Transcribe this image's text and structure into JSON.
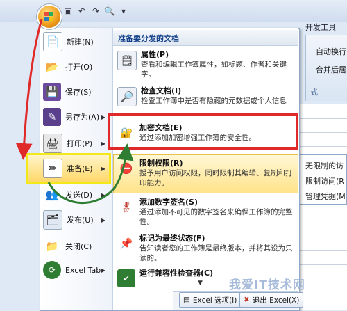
{
  "ribbon": {
    "dev_tab": "开发工具",
    "items": [
      "自动换行",
      "合并后居",
      "式"
    ],
    "right_items": [
      "无限制的访",
      "限制访问(R",
      "管理凭据(M"
    ]
  },
  "left_menu": {
    "items": [
      {
        "label": "新建(N)"
      },
      {
        "label": "打开(O)"
      },
      {
        "label": "保存(S)"
      },
      {
        "label": "另存为(A)"
      },
      {
        "label": "打印(P)"
      },
      {
        "label": "准备(E)"
      },
      {
        "label": "发送(D)"
      },
      {
        "label": "发布(U)"
      },
      {
        "label": "关闭(C)"
      },
      {
        "label": "Excel Tab"
      }
    ]
  },
  "right_panel": {
    "header": "准备要分发的文档",
    "items": [
      {
        "title": "属性(P)",
        "desc": "查看和编辑工作簿属性，如标题、作者和关键字。"
      },
      {
        "title": "检查文档(I)",
        "desc": "检查工作簿中是否有隐藏的元数据或个人信息"
      },
      {
        "title": "加密文档(E)",
        "desc": "通过添加加密增强工作簿的安全性。"
      },
      {
        "title": "限制权限(R)",
        "desc": "授予用户访问权限，同时限制其编辑、复制和打印能力。"
      },
      {
        "title": "添加数字签名(S)",
        "desc": "通过添加不可见的数字签名来确保工作簿的完整性。"
      },
      {
        "title": "标记为最终状态(F)",
        "desc": "告知读者您的工作簿是最终版本，并将其设为只读的。"
      },
      {
        "title": "运行兼容性检查器(C)",
        "desc": ""
      }
    ]
  },
  "bottom": {
    "options_label": "Excel 选项(I)",
    "exit_label": "退出 Excel(X)"
  },
  "watermark": "我爱IT技术网"
}
